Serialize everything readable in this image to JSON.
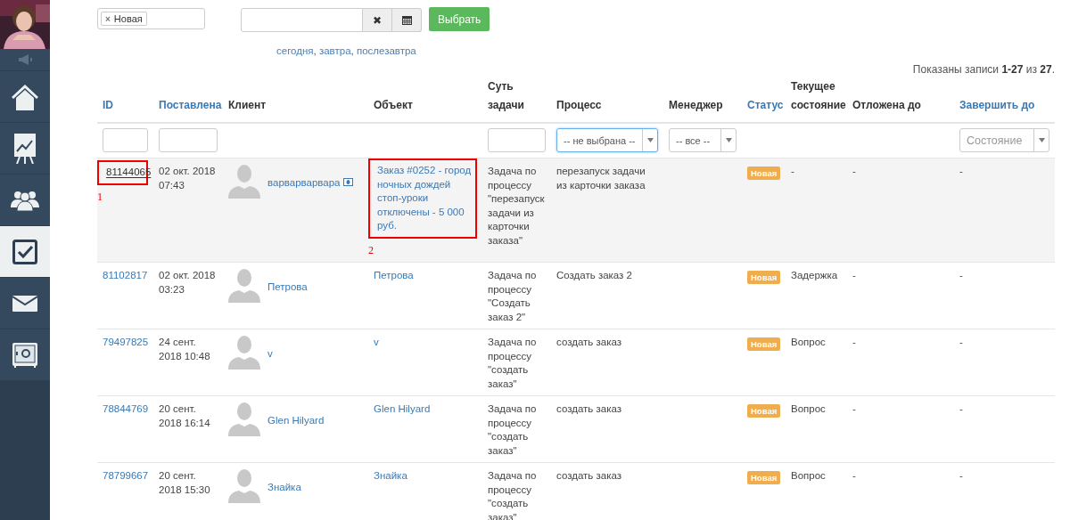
{
  "sidebar": {
    "items": [
      {
        "kind": "speaker",
        "selected": false
      },
      {
        "kind": "home",
        "selected": false
      },
      {
        "kind": "chart",
        "selected": false
      },
      {
        "kind": "people",
        "selected": false
      },
      {
        "kind": "tasks",
        "selected": true
      },
      {
        "kind": "mail",
        "selected": false
      },
      {
        "kind": "safe",
        "selected": false
      }
    ]
  },
  "filters": {
    "status_tags": [
      {
        "label": "Новая",
        "remove": "×"
      }
    ],
    "date_field": {
      "clear": "✖"
    },
    "apply_button": "Выбрать",
    "quick_dates": [
      {
        "label": "сегодня",
        "after": ","
      },
      {
        "label": "завтра",
        "after": ","
      },
      {
        "label": "послезавтра"
      }
    ]
  },
  "summary": "Показаны записи **1-27** из **27**.",
  "table": {
    "columns": [
      {
        "label": "ID",
        "sortable": true,
        "filter": {
          "kind": "input"
        }
      },
      {
        "label": "Поставлена",
        "sortable": true,
        "filter": {
          "kind": "input"
        }
      },
      {
        "label": "Клиент",
        "sortable": false,
        "filter": {
          "kind": "none"
        }
      },
      {
        "label": "Объект",
        "sortable": false,
        "filter": {
          "kind": "none"
        }
      },
      {
        "label": "Суть задачи",
        "sortable": false,
        "filter": {
          "kind": "input"
        }
      },
      {
        "label": "Процесс",
        "sortable": false,
        "filter": {
          "kind": "select",
          "value": "-- не выбрана --",
          "focused": true
        }
      },
      {
        "label": "Менеджер",
        "sortable": false,
        "filter": {
          "kind": "select",
          "value": "-- все --",
          "focused": false
        }
      },
      {
        "label": "Статус",
        "sortable": true,
        "filter": {
          "kind": "none"
        }
      },
      {
        "label": "Текущее состояние",
        "sortable": false,
        "filter": {
          "kind": "none"
        }
      },
      {
        "label": "Отложена до",
        "sortable": false,
        "filter": {
          "kind": "none"
        }
      },
      {
        "label": "Завершить до",
        "sortable": true,
        "filter": {
          "kind": "select",
          "placeholder": "Состояние",
          "focused": false
        }
      }
    ],
    "rows": [
      {
        "highlighted": true,
        "id": "81144065",
        "created": "02 окт. 2018 07:43",
        "client": "варварварвара",
        "client_badge": {
          "kind": "banknote"
        },
        "object": "Заказ #0252 - город ночных дождей стоп-уроки отключены - 5 000 руб.",
        "essence": "Задача по процессу \"перезапуск задачи из карточки заказа\"",
        "process": "перезапуск задачи из карточки заказа",
        "status": "Новая",
        "state": "-",
        "postponed": "-",
        "deadline": "-",
        "id_annotation": "1",
        "object_annotation": "2"
      },
      {
        "highlighted": false,
        "id": "81102817",
        "created": "02 окт. 2018 03:23",
        "client": "Петрова",
        "object": "Петрова",
        "essence": "Задача по процессу \"Создать заказ 2\"",
        "process": "Создать заказ 2",
        "status": "Новая",
        "state": "Задержка",
        "postponed": "-",
        "deadline": "-"
      },
      {
        "highlighted": false,
        "id": "79497825",
        "created": "24 сент. 2018 10:48",
        "client": "v",
        "object": "v",
        "essence": "Задача по процессу \"создать заказ\"",
        "process": "создать заказ",
        "status": "Новая",
        "state": "Вопрос",
        "postponed": "-",
        "deadline": "-"
      },
      {
        "highlighted": false,
        "id": "78844769",
        "created": "20 сент. 2018 16:14",
        "client": "Glen Hilyard",
        "object": "Glen Hilyard",
        "essence": "Задача по процессу \"создать заказ\"",
        "process": "создать заказ",
        "status": "Новая",
        "state": "Вопрос",
        "postponed": "-",
        "deadline": "-"
      },
      {
        "highlighted": false,
        "id": "78799667",
        "created": "20 сент. 2018 15:30",
        "client": "Знайка",
        "object": "Знайка",
        "essence": "Задача по процессу \"создать заказ\"",
        "process": "создать заказ",
        "status": "Новая",
        "state": "Вопрос",
        "postponed": "-",
        "deadline": "-"
      }
    ]
  }
}
